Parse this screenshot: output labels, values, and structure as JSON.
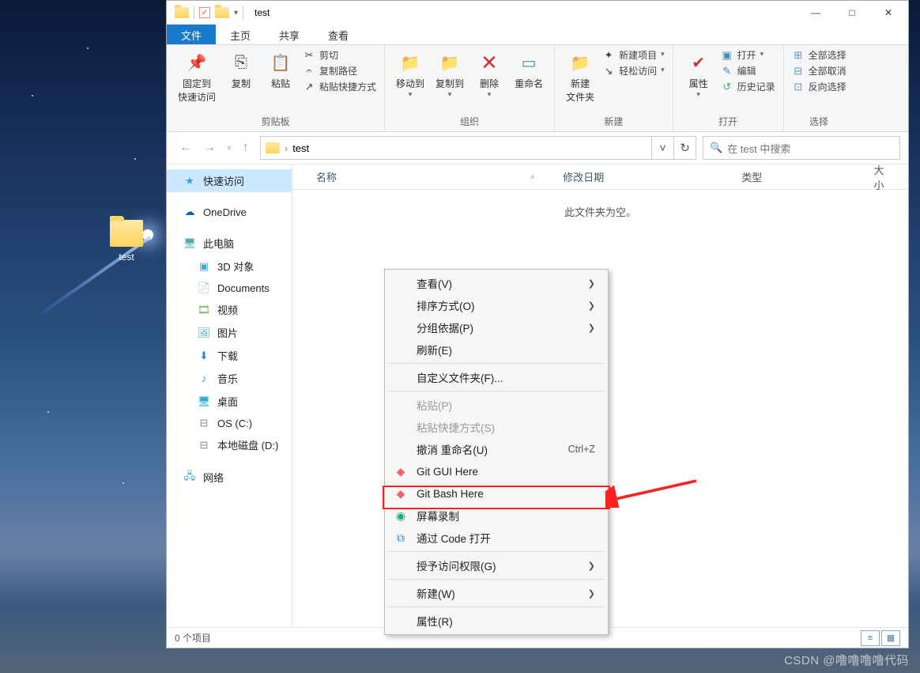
{
  "desktop": {
    "icon_label": "test"
  },
  "titlebar": {
    "title": "test",
    "qat_dropdown": "▾"
  },
  "win": {
    "min": "—",
    "max": "□",
    "close": "✕"
  },
  "menubar": {
    "file": "文件",
    "home": "主页",
    "share": "共享",
    "view": "查看"
  },
  "ribbon": {
    "clipboard": {
      "label": "剪贴板",
      "pin": "固定到\n快速访问",
      "copy": "复制",
      "paste": "粘贴",
      "cut": "剪切",
      "copy_path": "复制路径",
      "paste_shortcut": "粘贴快捷方式"
    },
    "organize": {
      "label": "组织",
      "move_to": "移动到",
      "copy_to": "复制到",
      "delete": "删除",
      "rename": "重命名"
    },
    "new": {
      "label": "新建",
      "new_folder": "新建\n文件夹",
      "new_item": "新建项目",
      "easy_access": "轻松访问"
    },
    "open": {
      "label": "打开",
      "properties": "属性",
      "open": "打开",
      "edit": "编辑",
      "history": "历史记录"
    },
    "select": {
      "label": "选择",
      "select_all": "全部选择",
      "select_none": "全部取消",
      "invert": "反向选择"
    }
  },
  "address": {
    "crumb": "test",
    "search_placeholder": "在 test 中搜索"
  },
  "tree": {
    "quick_access": "快速访问",
    "onedrive": "OneDrive",
    "this_pc": "此电脑",
    "objects_3d": "3D 对象",
    "documents": "Documents",
    "videos": "视频",
    "pictures": "图片",
    "downloads": "下载",
    "music": "音乐",
    "desktop": "桌面",
    "os_c": "OS (C:)",
    "local_d": "本地磁盘 (D:)",
    "network": "网络"
  },
  "columns": {
    "name": "名称",
    "modified": "修改日期",
    "type": "类型",
    "size": "大小"
  },
  "content": {
    "empty": "此文件夹为空。"
  },
  "context_menu": {
    "view": "查看(V)",
    "sort": "排序方式(O)",
    "group": "分组依据(P)",
    "refresh": "刷新(E)",
    "customize": "自定义文件夹(F)...",
    "paste": "粘贴(P)",
    "paste_shortcut": "粘贴快捷方式(S)",
    "undo_rename": "撤消 重命名(U)",
    "undo_shortcut": "Ctrl+Z",
    "git_gui": "Git GUI Here",
    "git_bash": "Git Bash Here",
    "screen_rec": "屏幕录制",
    "open_code": "通过 Code 打开",
    "grant_access": "授予访问权限(G)",
    "new": "新建(W)",
    "properties": "属性(R)"
  },
  "status": {
    "items": "0 个项目"
  },
  "watermark": "CSDN @噜噜噜噜代码"
}
